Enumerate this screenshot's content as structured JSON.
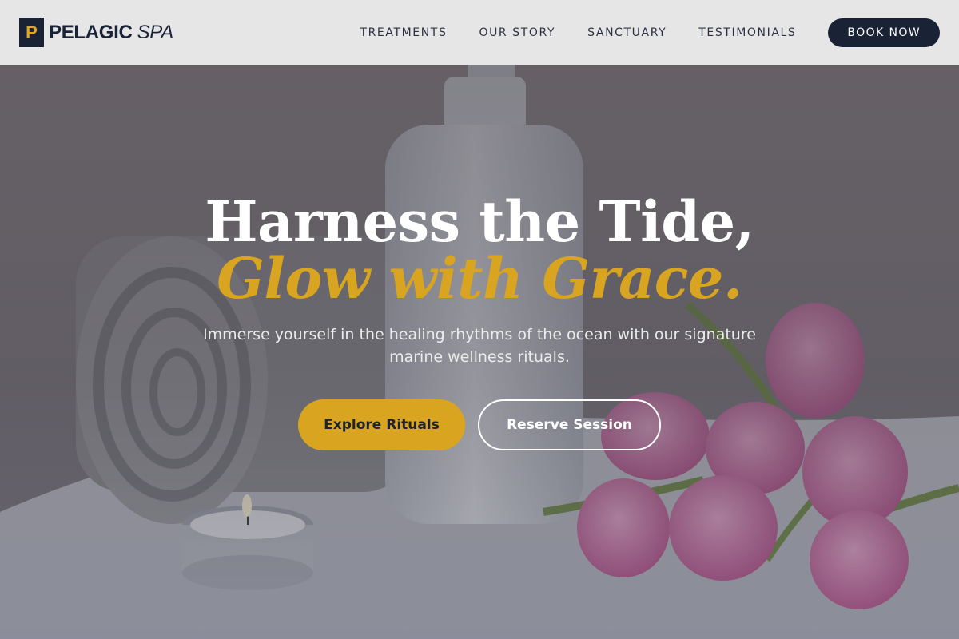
{
  "brand": {
    "mark": "P",
    "name_bold": "PELAGIC",
    "name_italic": "SPA"
  },
  "nav": {
    "items": [
      {
        "label": "TREATMENTS"
      },
      {
        "label": "OUR STORY"
      },
      {
        "label": "SANCTUARY"
      },
      {
        "label": "TESTIMONIALS"
      }
    ],
    "book_label": "BOOK NOW"
  },
  "hero": {
    "title_line1": "Harness the Tide,",
    "title_line2": "Glow with Grace.",
    "subtitle": "Immerse yourself in the healing rhythms of the ocean with our signature marine wellness rituals.",
    "primary_cta": "Explore Rituals",
    "secondary_cta": "Reserve Session"
  },
  "colors": {
    "navy": "#1a2236",
    "gold": "#d9a520",
    "header_bg": "#e6e6e7"
  }
}
